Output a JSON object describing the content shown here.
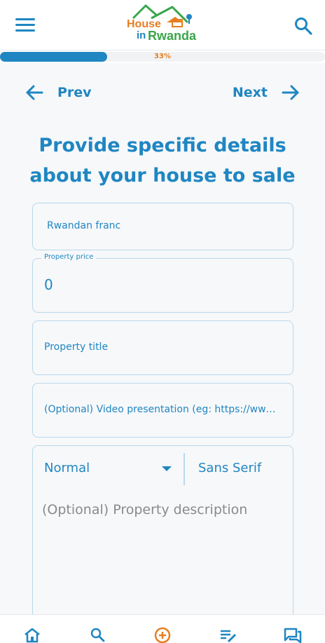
{
  "header": {
    "logo_line1": "House",
    "logo_line2a": "in",
    "logo_line2b": "Rwanda",
    "icons": {
      "menu": "menu-icon",
      "search": "search-icon"
    }
  },
  "progress": {
    "value": 0.33,
    "label": "33%"
  },
  "nav": {
    "prev_label": "Prev",
    "next_label": "Next"
  },
  "heading": "Provide specific details about your house to sale",
  "form": {
    "currency": {
      "value": "Rwandan franc"
    },
    "price": {
      "label": "Property price",
      "value": "0"
    },
    "title": {
      "placeholder": "Property title"
    },
    "video": {
      "placeholder": "(Optional) Video presentation (eg: https://www.youtube.com/...)"
    },
    "description": {
      "size_select": "Normal",
      "font_select": "Sans Serif",
      "placeholder": "(Optional) Property description"
    }
  },
  "bottom_nav": {
    "icons": [
      "home-icon",
      "search-icon",
      "add-circle-icon",
      "edit-list-icon",
      "chat-icon"
    ]
  },
  "colors": {
    "primary": "#1f86c2",
    "accent": "#e67e22",
    "green": "#3aa64a"
  }
}
